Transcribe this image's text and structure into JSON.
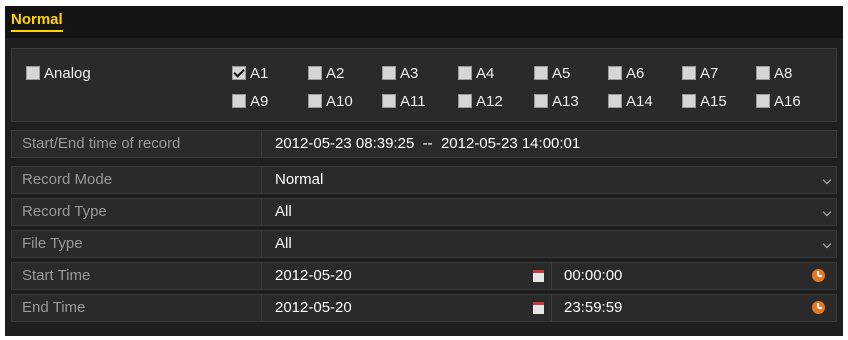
{
  "tab": {
    "label": "Normal"
  },
  "channels": {
    "analog_label": "Analog",
    "items": [
      {
        "label": "A1",
        "checked": true
      },
      {
        "label": "A2",
        "checked": false
      },
      {
        "label": "A3",
        "checked": false
      },
      {
        "label": "A4",
        "checked": false
      },
      {
        "label": "A5",
        "checked": false
      },
      {
        "label": "A6",
        "checked": false
      },
      {
        "label": "A7",
        "checked": false
      },
      {
        "label": "A8",
        "checked": false
      },
      {
        "label": "A9",
        "checked": false
      },
      {
        "label": "A10",
        "checked": false
      },
      {
        "label": "A11",
        "checked": false
      },
      {
        "label": "A12",
        "checked": false
      },
      {
        "label": "A13",
        "checked": false
      },
      {
        "label": "A14",
        "checked": false
      },
      {
        "label": "A15",
        "checked": false
      },
      {
        "label": "A16",
        "checked": false
      }
    ]
  },
  "record_span": {
    "label": "Start/End time of record",
    "value": "2012-05-23 08:39:25  --  2012-05-23 14:00:01"
  },
  "record_mode": {
    "label": "Record Mode",
    "value": "Normal"
  },
  "record_type": {
    "label": "Record Type",
    "value": "All"
  },
  "file_type": {
    "label": "File Type",
    "value": "All"
  },
  "start_time": {
    "label": "Start Time",
    "date": "2012-05-20",
    "time": "00:00:00"
  },
  "end_time": {
    "label": "End Time",
    "date": "2012-05-20",
    "time": "23:59:59"
  },
  "icons": {
    "calendar": "calendar-icon",
    "clock": "clock-icon",
    "dropdown": "chevron-down-icon"
  },
  "colors": {
    "tab_accent": "#ffd400",
    "clock": "#e87722",
    "calendar_top": "#c83c3c"
  }
}
